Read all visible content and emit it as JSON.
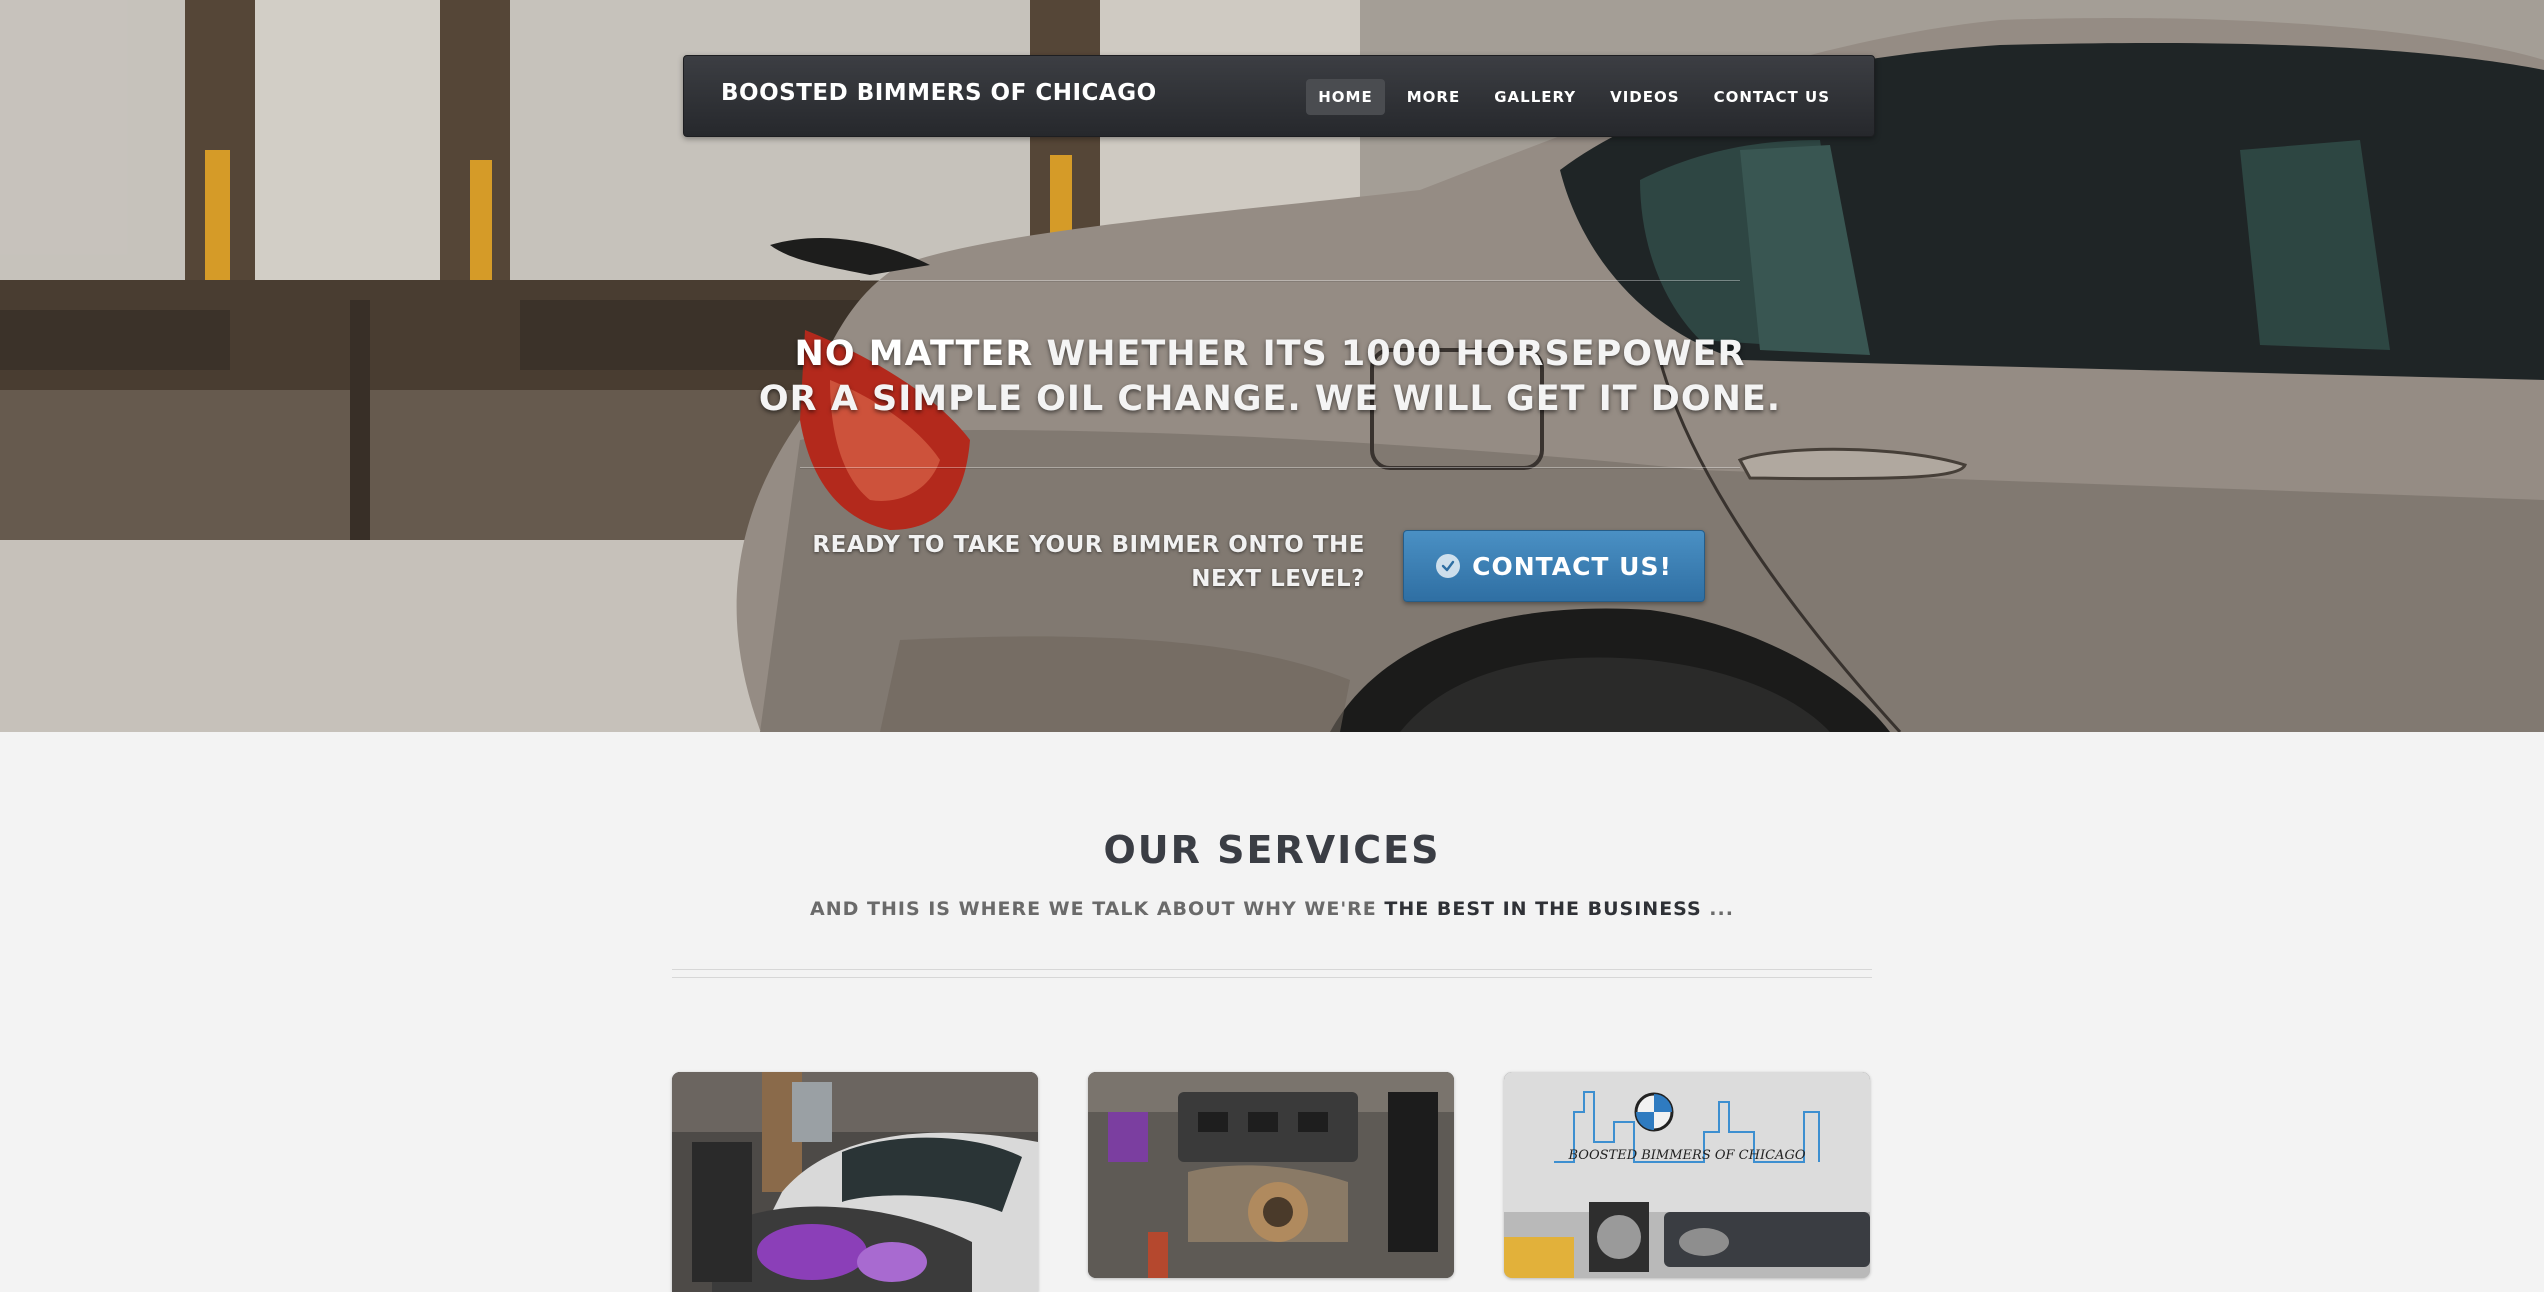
{
  "nav": {
    "brand": "BOOSTED BIMMERS OF CHICAGO",
    "items": [
      {
        "label": "HOME",
        "active": true
      },
      {
        "label": "MORE",
        "active": false
      },
      {
        "label": "GALLERY",
        "active": false
      },
      {
        "label": "VIDEOS",
        "active": false
      },
      {
        "label": "CONTACT US",
        "active": false
      }
    ]
  },
  "hero": {
    "headline_strong": "NO MATTER",
    "headline_line1_rest": " WHETHER ITS 1000 HORSEPOWER",
    "headline_line2": "OR A SIMPLE OIL CHANGE. WE WILL GET IT DONE.",
    "cta_text": "READY TO TAKE YOUR BIMMER ONTO THE NEXT LEVEL?",
    "cta_button": "CONTACT US!",
    "cta_icon": "check-circle-icon"
  },
  "services": {
    "title": "OUR SERVICES",
    "subtitle_prefix": "AND THIS IS WHERE WE TALK ABOUT WHY WE'RE ",
    "subtitle_emphasis": "THE BEST IN THE BUSINESS",
    "subtitle_suffix": " ...",
    "wall_logo_text": "BOOSTED BIMMERS OF CHICAGO"
  },
  "colors": {
    "nav_bg": "#2e3034",
    "cta_button": "#3a80b6",
    "page_bg": "#f3f3f3",
    "title_text": "#3a3d44"
  }
}
